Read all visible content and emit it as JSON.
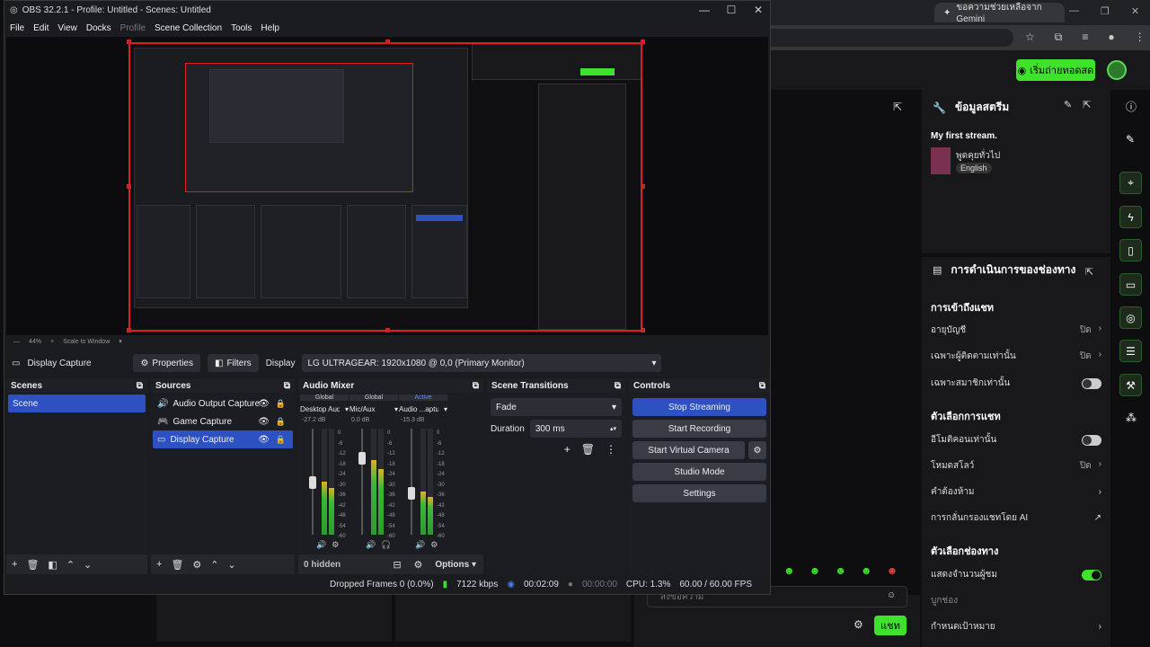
{
  "obs": {
    "title": "OBS 32.2.1 - Profile: Untitled - Scenes: Untitled",
    "menu": [
      "File",
      "Edit",
      "View",
      "Docks",
      "Profile",
      "Scene Collection",
      "Tools",
      "Help"
    ],
    "zoom": "44%",
    "scale_mode": "Scale to Window",
    "source_bar": {
      "selected_source": "Display Capture",
      "properties": "Properties",
      "filters": "Filters",
      "display_label": "Display",
      "display_value": "LG ULTRAGEAR: 1920x1080 @ 0,0 (Primary Monitor)"
    },
    "scenes": {
      "title": "Scenes",
      "items": [
        "Scene"
      ]
    },
    "sources": {
      "title": "Sources",
      "items": [
        "Audio Output Capture",
        "Game Capture",
        "Display Capture"
      ]
    },
    "mixer": {
      "title": "Audio Mixer",
      "channels": [
        {
          "scope": "Global",
          "name": "Desktop Audio",
          "db": "-27.2 dB",
          "level": 0.55
        },
        {
          "scope": "Global",
          "name": "Mic/Aux",
          "db": "0.0 dB",
          "level": 0.78
        },
        {
          "scope": "Active",
          "name": "Audio ...apture",
          "db": "-15.3 dB",
          "level": 0.45
        }
      ],
      "ticks": [
        "0",
        "-6",
        "-12",
        "-18",
        "-24",
        "-30",
        "-36",
        "-42",
        "-48",
        "-54",
        "-60"
      ],
      "hidden": "0 hidden",
      "options": "Options"
    },
    "transitions": {
      "title": "Scene Transitions",
      "value": "Fade",
      "duration_label": "Duration",
      "duration_value": "300 ms"
    },
    "controls": {
      "title": "Controls",
      "stop_streaming": "Stop Streaming",
      "start_recording": "Start Recording",
      "start_virtual_camera": "Start Virtual Camera",
      "studio_mode": "Studio Mode",
      "settings": "Settings"
    },
    "status": {
      "dropped": "Dropped Frames 0 (0.0%)",
      "kbps": "7122 kbps",
      "stream_time": "00:02:09",
      "rec_time": "00:00:00",
      "cpu": "CPU: 1.3%",
      "fps": "60.00 / 60.00 FPS"
    }
  },
  "browser": {
    "tab_label": "ขอความช่วยเหลือจาก Gemini"
  },
  "twitch": {
    "go_live": "เริ่มถ่ายทอดสด",
    "stream_info": {
      "title": "ข้อมูลสตรีม",
      "stream_title": "My first stream.",
      "category": "พูดคุยทั่วไป",
      "language": "English"
    },
    "channel_actions": {
      "title": "การดำเนินการของช่องทาง",
      "chat_access": "การเข้าถึงแชท",
      "account_age": "อายุบัญชี",
      "account_age_val": "ปิด",
      "followers_only": "เฉพาะผู้ติดตามเท่านั้น",
      "followers_only_val": "ปิด",
      "subs_only": "เฉพาะสมาชิกเท่านั้น",
      "chat_options": "ตัวเลือกการแชท",
      "emote_only": "อีโมติคอนเท่านั้น",
      "slow_mode": "โหมดสโลว์",
      "slow_mode_val": "ปิด",
      "blocked_terms": "คำต้องห้าม",
      "ai_filter": "การกลั่นกรองแชทโดย AI",
      "channel_options": "ตัวเลือกช่องทาง",
      "show_viewers": "แสดงจำนวนผู้ชม",
      "goals": "บูกช่อง",
      "set_goal": "กำหนดเป้าหมาย"
    },
    "chat_placeholder": "ส่งข้อความ",
    "chat_button": "แชท"
  }
}
